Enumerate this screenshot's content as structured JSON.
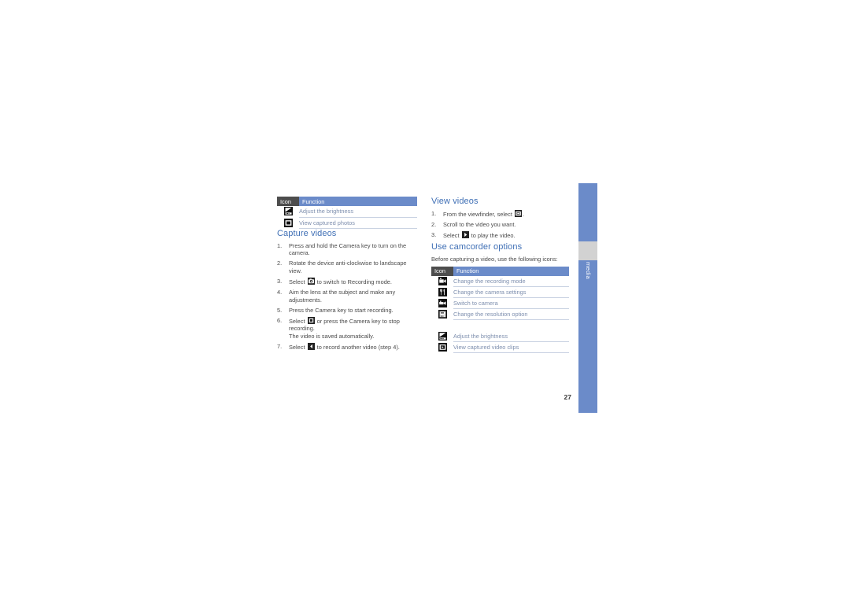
{
  "page": {
    "number": "27",
    "side_tab_label": "media"
  },
  "colors": {
    "heading_blue": "#3f6fb5",
    "tab_blue": "#6b8bc9",
    "tab_gray": "#d2d2d2",
    "table_header_icon_bg": "#4d4d4d",
    "table_header_function_bg": "#6b8bc9",
    "table_text_blue": "#7e8fae",
    "body_text": "#4a4a4a"
  },
  "left_column": {
    "table": {
      "headers": {
        "icon": "Icon",
        "function": "Function"
      },
      "rows": [
        {
          "icon": "brightness-icon",
          "function": "Adjust the brightness"
        },
        {
          "icon": "view-photos-icon",
          "function": "View captured photos"
        }
      ]
    },
    "section": {
      "heading": "Capture videos",
      "steps": [
        {
          "text_before": "Press and hold the Camera key to turn on the camera.",
          "icon": null,
          "text_after": ""
        },
        {
          "text_before": "Rotate the device anti-clockwise to landscape view.",
          "icon": null,
          "text_after": ""
        },
        {
          "text_before": "Select ",
          "icon": "camera-icon",
          "text_after": " to switch to Recording mode."
        },
        {
          "text_before": "Aim the lens at the subject and make any adjustments.",
          "icon": null,
          "text_after": ""
        },
        {
          "text_before": "Press the Camera key to start recording.",
          "icon": null,
          "text_after": ""
        },
        {
          "text_before": "Select ",
          "icon": "stop-icon",
          "text_after": " or press the Camera key to stop recording.",
          "sub_line": "The video is saved automatically."
        },
        {
          "text_before": "Select ",
          "icon": "back-icon",
          "text_after": " to record another video (step 4)."
        }
      ]
    }
  },
  "right_column": {
    "view_videos": {
      "heading": "View videos",
      "steps": [
        {
          "text_before": "From the viewfinder, select ",
          "icon": "view-videos-icon",
          "text_after": "."
        },
        {
          "text_before": "Scroll to the video you want.",
          "icon": null,
          "text_after": ""
        },
        {
          "text_before": "Select ",
          "icon": "play-icon",
          "text_after": " to play the video."
        }
      ]
    },
    "camcorder_options": {
      "heading": "Use camcorder options",
      "intro": "Before capturing a video, use the following icons:",
      "table": {
        "headers": {
          "icon": "Icon",
          "function": "Function"
        },
        "rows": [
          {
            "icon": "recording-mode-icon",
            "function": "Change the recording mode"
          },
          {
            "icon": "camera-settings-icon",
            "function": "Change the camera settings"
          },
          {
            "icon": "switch-to-camera-icon",
            "function": "Switch to camera"
          },
          {
            "icon": "resolution-icon",
            "function": "Change the resolution option"
          },
          {
            "icon": "brightness-icon",
            "function": "Adjust the brightness",
            "gap_before": true
          },
          {
            "icon": "view-video-clips-icon",
            "function": "View captured video clips"
          }
        ]
      }
    }
  }
}
